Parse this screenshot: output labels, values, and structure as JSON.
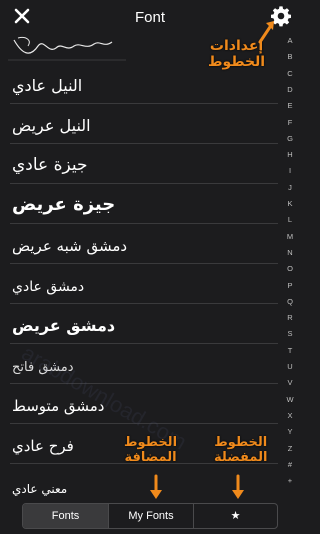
{
  "header": {
    "title": "Font",
    "close_icon": "close-icon",
    "settings_icon": "gear-icon"
  },
  "fonts": [
    {
      "label": "النيل عادي"
    },
    {
      "label": "النيل عريض"
    },
    {
      "label": "جيزة عادي"
    },
    {
      "label": "جيزة عريض"
    },
    {
      "label": "دمشق شبه عريض"
    },
    {
      "label": "دمشق عادي"
    },
    {
      "label": "دمشق عريض"
    },
    {
      "label": "دمشق فاتح"
    },
    {
      "label": "دمشق متوسط"
    },
    {
      "label": "فرح عادي"
    },
    {
      "label": "معني عادي"
    }
  ],
  "index_letters": [
    "A",
    "B",
    "C",
    "D",
    "E",
    "F",
    "G",
    "H",
    "I",
    "J",
    "K",
    "L",
    "M",
    "N",
    "O",
    "P",
    "Q",
    "R",
    "S",
    "T",
    "U",
    "V",
    "W",
    "X",
    "Y",
    "Z",
    "#",
    "+"
  ],
  "annotations": {
    "settings": "إعدادات\nالخطوط",
    "added": "الخطوط\nالمضافة",
    "favorite": "الخطوط\nالمفضلة"
  },
  "tabs": {
    "fonts": "Fonts",
    "my_fonts": "My Fonts",
    "favorites": "★"
  },
  "watermark": "arabdownload.com",
  "colors": {
    "background": "#1c1c1e",
    "annotation": "#f08a1c",
    "separator": "#3a3a3c"
  }
}
